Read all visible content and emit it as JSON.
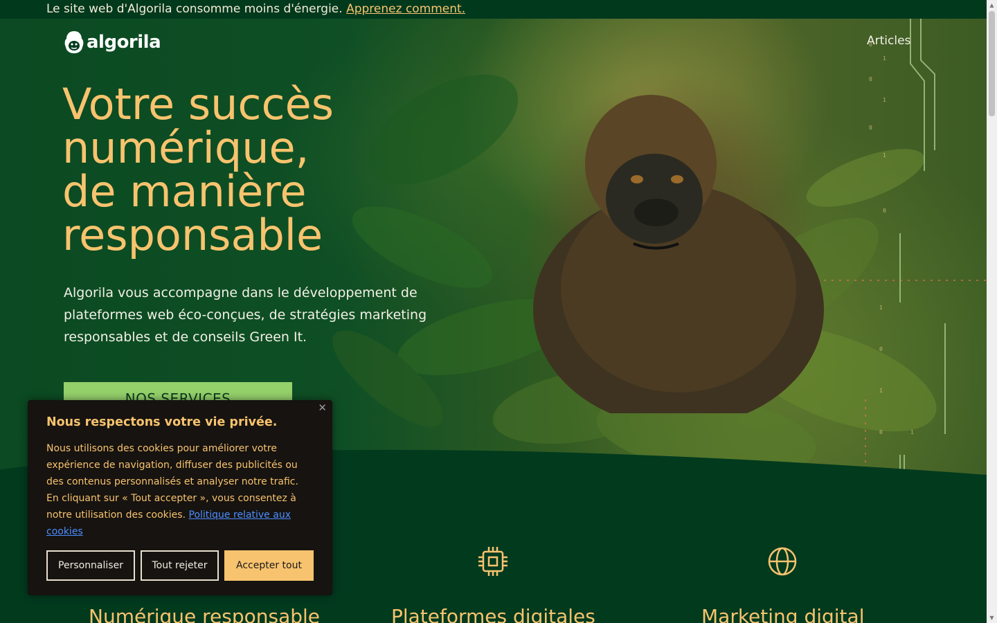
{
  "notice": {
    "text": "Le site web d'Algorila consomme moins d'énergie.",
    "link": "Apprenez comment."
  },
  "header": {
    "logo_text": "algorila",
    "nav": [
      "Articles"
    ]
  },
  "hero": {
    "title_lines": [
      "Votre succès",
      "numérique,",
      "de manière",
      "responsable"
    ],
    "description": "Algorila vous accompagne dans le développement de plateformes web éco-conçues, de stratégies marketing responsables et de conseils Green It.",
    "cta": "NOS SERVICES"
  },
  "services": [
    {
      "title": "Numérique responsable",
      "icon": "leaf-icon"
    },
    {
      "title": "Plateformes digitales",
      "icon": "cpu-chip-icon"
    },
    {
      "title": "Marketing digital",
      "icon": "globe-icon"
    }
  ],
  "cookie_banner": {
    "title": "Nous respectons votre vie privée.",
    "body": "Nous utilisons des cookies pour améliorer votre expérience de navigation, diffuser des publicités ou des contenus personnalisés et analyser notre trafic. En cliquant sur « Tout accepter », vous consentez à notre utilisation des cookies.",
    "policy_link": "Politique relative aux cookies",
    "buttons": {
      "customize": "Personnaliser",
      "reject": "Tout rejeter",
      "accept": "Accepter tout"
    }
  },
  "colors": {
    "background": "#023a1e",
    "accent": "#f8c36e",
    "cta": "#95d16b",
    "banner": "#161310",
    "link": "#4c8eff"
  }
}
